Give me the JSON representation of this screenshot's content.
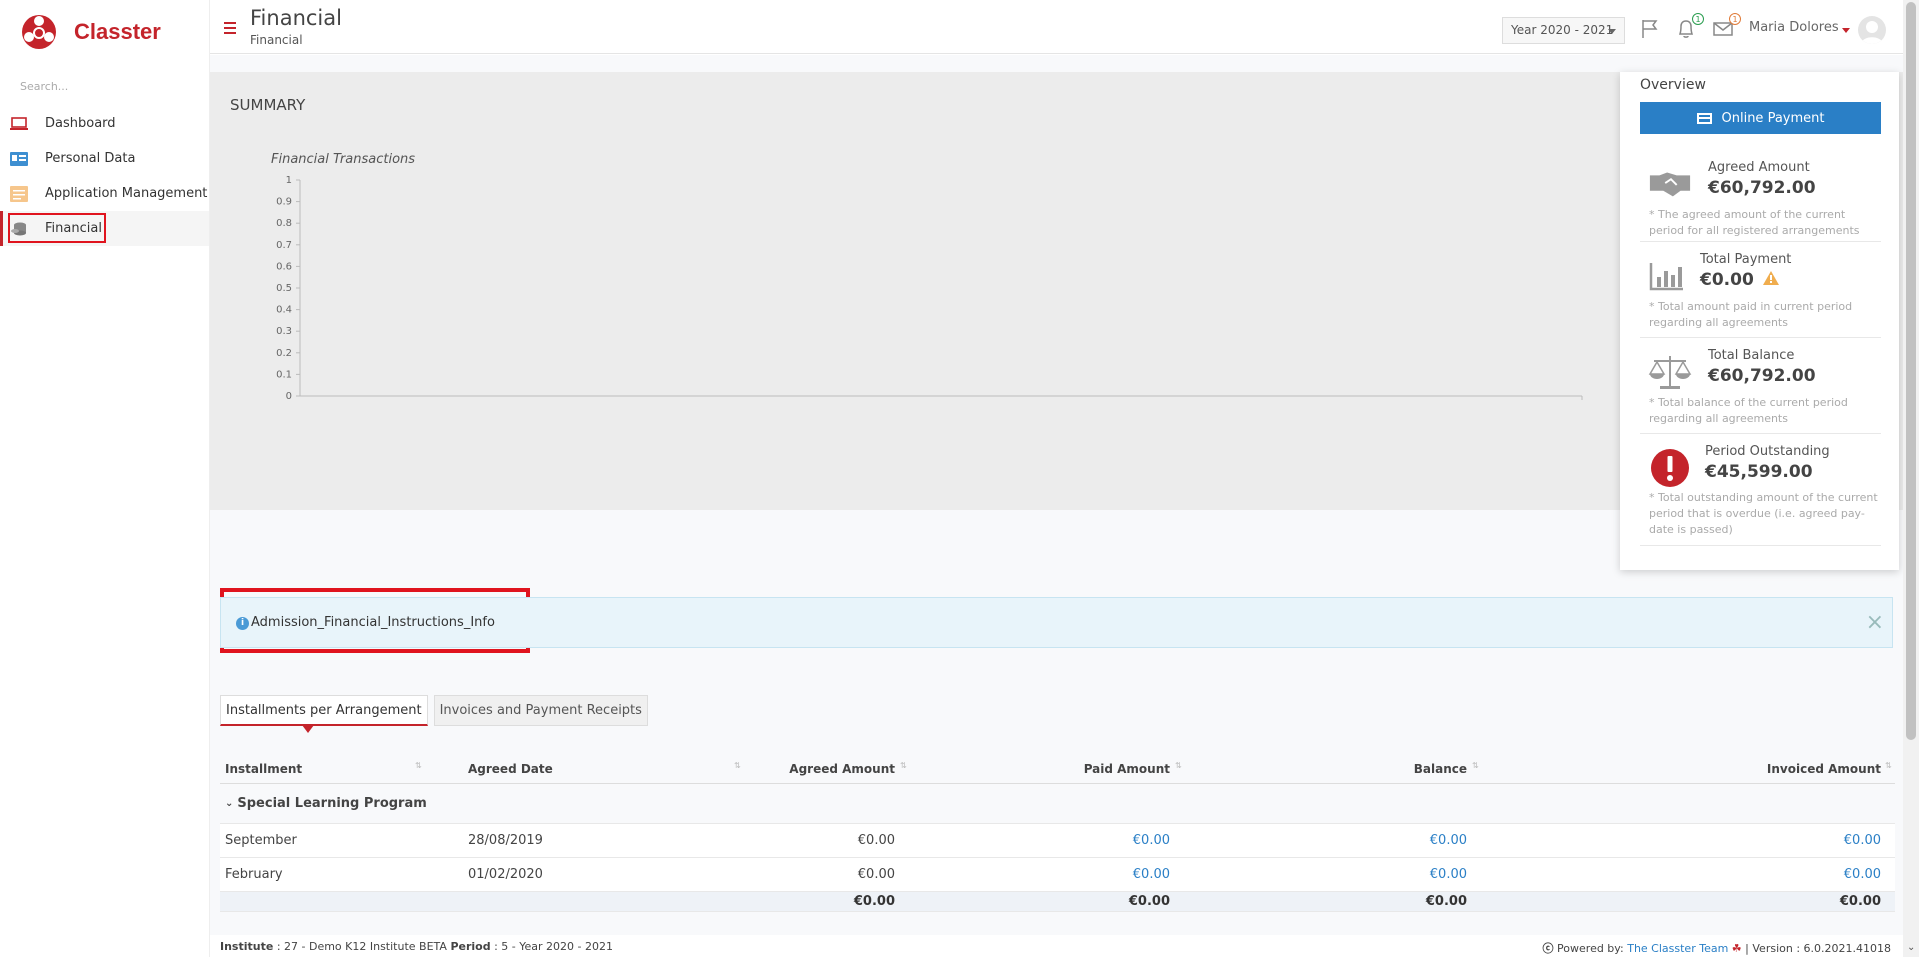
{
  "app": {
    "name": "Classter"
  },
  "sidebar": {
    "search_placeholder": "Search...",
    "items": [
      {
        "label": "Dashboard",
        "icon": "laptop-icon"
      },
      {
        "label": "Personal Data",
        "icon": "id-card-icon"
      },
      {
        "label": "Application Management",
        "icon": "forms-icon"
      },
      {
        "label": "Financial",
        "icon": "coins-icon",
        "active": true
      }
    ]
  },
  "header": {
    "title": "Financial",
    "subtitle": "Financial",
    "year": "Year 2020 - 2021",
    "notifications_count": "1",
    "messages_count": "1",
    "user": "Maria Dolores"
  },
  "summary": {
    "title": "SUMMARY",
    "chart_title": "Financial Transactions"
  },
  "chart_data": {
    "type": "line",
    "title": "Financial Transactions",
    "x": [],
    "series": [],
    "ylim": [
      0,
      1
    ],
    "yticks": [
      "1",
      "0.9",
      "0.8",
      "0.7",
      "0.6",
      "0.5",
      "0.4",
      "0.3",
      "0.2",
      "0.1",
      "0"
    ],
    "grid": false
  },
  "overview": {
    "title": "Overview",
    "pay_button": "Online Payment",
    "items": [
      {
        "label": "Agreed Amount",
        "value": "€60,792.00",
        "note": "* The agreed amount of the current period for all registered arrangements",
        "icon": "handshake-icon"
      },
      {
        "label": "Total Payment",
        "value": "€0.00",
        "note": "* Total amount paid in current period regarding all agreements",
        "icon": "bar-chart-icon"
      },
      {
        "label": "Total Balance",
        "value": "€60,792.00",
        "note": "* Total balance of the current period regarding all agreements",
        "icon": "balance-scale-icon"
      },
      {
        "label": "Period Outstanding",
        "value": "€45,599.00",
        "note": "* Total outstanding amount of the current period that is overdue (i.e. agreed pay-date is passed)",
        "icon": "exclamation-icon"
      }
    ]
  },
  "alert": {
    "text": "Admission_Financial_Instructions_Info",
    "close": "×"
  },
  "tabs": [
    {
      "label": "Installments per Arrangement",
      "active": true
    },
    {
      "label": "Invoices and Payment Receipts",
      "active": false
    }
  ],
  "table": {
    "columns": [
      "Installment",
      "Agreed Date",
      "Agreed Amount",
      "Paid Amount",
      "Balance",
      "Invoiced Amount"
    ],
    "group": "Special Learning Program",
    "rows": [
      {
        "installment": "September",
        "date": "28/08/2019",
        "agreed": "€0.00",
        "paid": "€0.00",
        "balance": "€0.00",
        "invoiced": "€0.00"
      },
      {
        "installment": "February",
        "date": "01/02/2020",
        "agreed": "€0.00",
        "paid": "€0.00",
        "balance": "€0.00",
        "invoiced": "€0.00"
      }
    ],
    "totals": {
      "agreed": "€0.00",
      "paid": "€0.00",
      "balance": "€0.00",
      "invoiced": "€0.00"
    }
  },
  "footer": {
    "institute_label": "Institute",
    "institute_value": ": 27 - Demo K12 Institute BETA",
    "period_label": "Period",
    "period_value": ": 5 - Year 2020 - 2021",
    "powered_by": "Powered by:",
    "team": "The Classter Team",
    "version": "| Version : 6.0.2021.41018"
  }
}
